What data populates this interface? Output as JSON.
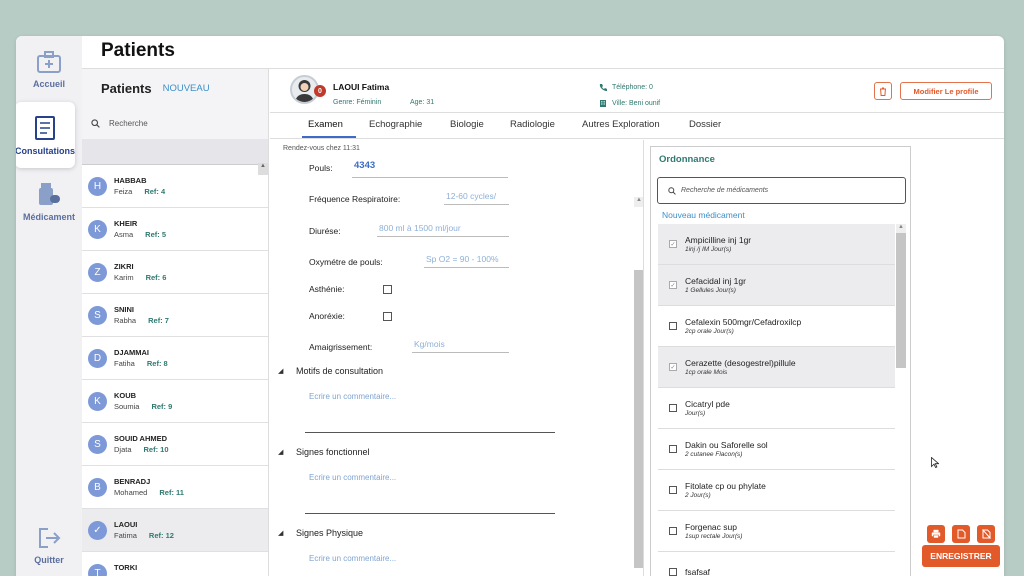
{
  "app": {
    "page_title": "Patients"
  },
  "nav": {
    "items": [
      {
        "label": "Accueil",
        "icon": "medical-kit-icon"
      },
      {
        "label": "Consultations",
        "icon": "clipboard-icon"
      },
      {
        "label": "Médicament",
        "icon": "medication-icon"
      },
      {
        "label": "Quitter",
        "icon": "logout-icon"
      }
    ]
  },
  "patients_panel": {
    "title": "Patients",
    "new_label": "NOUVEAU",
    "search_placeholder": "Recherche",
    "rows": [
      {
        "initial": "H",
        "last": "HABBAB",
        "first": "Feiza",
        "ref": "Ref: 4"
      },
      {
        "initial": "K",
        "last": "KHEIR",
        "first": "Asma",
        "ref": "Ref: 5"
      },
      {
        "initial": "Z",
        "last": "ZIKRI",
        "first": "Karim",
        "ref": "Ref: 6"
      },
      {
        "initial": "S",
        "last": "SNINI",
        "first": "Rabha",
        "ref": "Ref: 7"
      },
      {
        "initial": "D",
        "last": "DJAMMAI",
        "first": "Fatiha",
        "ref": "Ref: 8"
      },
      {
        "initial": "K",
        "last": "KOUB",
        "first": "Soumia",
        "ref": "Ref: 9"
      },
      {
        "initial": "S",
        "last": "SOUID AHMED",
        "first": "Djata",
        "ref": "Ref: 10"
      },
      {
        "initial": "B",
        "last": "BENRADJ",
        "first": "Mohamed",
        "ref": "Ref: 11"
      },
      {
        "initial": "✓",
        "last": "LAOUI",
        "first": "Fatima",
        "ref": "Ref: 12"
      },
      {
        "initial": "T",
        "last": "TORKI",
        "first": "",
        "ref": ""
      }
    ]
  },
  "patient": {
    "name": "LAOUI Fatima",
    "badge": "0",
    "genre": "Genre: Féminin",
    "age": "Age: 31",
    "phone": "Téléphone: 0",
    "city": "Ville: Beni ounif",
    "modify_label": "Modifier Le profile"
  },
  "tabs": [
    {
      "label": "Examen"
    },
    {
      "label": "Echographie"
    },
    {
      "label": "Biologie"
    },
    {
      "label": "Radiologie"
    },
    {
      "label": "Autres Exploration"
    },
    {
      "label": "Dossier"
    }
  ],
  "exam": {
    "rdv": "Rendez-vous chez 11:31",
    "pouls_label": "Pouls:",
    "pouls_value": "4343",
    "freq_label": "Fréquence Respiratoire:",
    "freq_placeholder": "12-60 cycles/",
    "diurese_label": "Diurése:",
    "diurese_placeholder": "800 ml à 1500 ml/jour",
    "oxy_label": "Oxymétre de pouls:",
    "oxy_placeholder": "Sp O2 = 90 - 100%",
    "asthenie_label": "Asthénie:",
    "anorexie_label": "Anoréxie:",
    "amaig_label": "Amaigrissement:",
    "amaig_placeholder": "Kg/mois",
    "sections": [
      {
        "title": "Motifs de consultation",
        "comment": "Ecrire un commentaire..."
      },
      {
        "title": "Signes fonctionnel",
        "comment": "Ecrire un commentaire..."
      },
      {
        "title": "Signes Physique",
        "comment": "Ecrire un commentaire..."
      }
    ]
  },
  "ordonnance": {
    "title": "Ordonnance",
    "search_placeholder": "Recherche de médicaments",
    "new_label": "Nouveau médicament",
    "meds": [
      {
        "name": "Ampicilline  inj 1gr",
        "dose": "1inj /j IM Jour(s)",
        "checked": true
      },
      {
        "name": "Cefacidal inj 1gr",
        "dose": "1 Gellules Jour(s)",
        "checked": true
      },
      {
        "name": "Cefalexin 500mgr/Cefadroxilcp",
        "dose": "2cp orale Jour(s)",
        "checked": false
      },
      {
        "name": "Cerazette (desogestrel)pillule",
        "dose": "1cp orale Mois",
        "checked": true
      },
      {
        "name": "Cicatryl pde",
        "dose": " Jour(s)",
        "checked": false
      },
      {
        "name": "Dakin ou Saforelle sol",
        "dose": "2 cutanee Flacon(s)",
        "checked": false
      },
      {
        "name": "Fitolate cp ou phylate",
        "dose": "2  Jour(s)",
        "checked": false
      },
      {
        "name": "Forgenac sup",
        "dose": "1sup rectale Jour(s)",
        "checked": false
      },
      {
        "name": "fsafsaf",
        "dose": "",
        "checked": false
      }
    ]
  },
  "actions": {
    "save_label": "ENREGISTRER",
    "icons": [
      "print-icon",
      "document-icon",
      "no-document-icon"
    ]
  },
  "colors": {
    "accent": "#e25a2a",
    "teal": "#2f7a70",
    "link": "#3c8fc8",
    "nav": "#5b6f9e"
  }
}
